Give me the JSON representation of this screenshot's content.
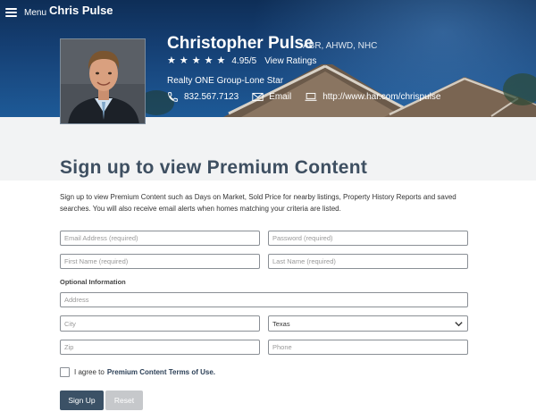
{
  "topbar": {
    "menu_label": "Menu",
    "site_agent_name": "Chris Pulse"
  },
  "agent": {
    "full_name": "Christopher Pulse",
    "credentials": "ABR, AHWD, NHC",
    "rating": "4.95/5",
    "stars": 5,
    "view_ratings_label": "View Ratings",
    "brokerage": "Realty ONE Group-Lone Star",
    "phone": "832.567.7123",
    "email_label": "Email",
    "website": "http://www.har.com/chrispulse"
  },
  "page": {
    "title": "Sign up to view Premium Content",
    "intro": "Sign up to view Premium Content such as Days on Market, Sold Price for nearby listings, Property History Reports and saved searches. You will also receive email alerts when homes matching your criteria are listed."
  },
  "form": {
    "email_placeholder": "Email Address (required)",
    "password_placeholder": "Password (required)",
    "first_name_placeholder": "First Name (required)",
    "last_name_placeholder": "Last Name (required)",
    "optional_label": "Optional Information",
    "address_placeholder": "Address",
    "city_placeholder": "City",
    "state_selected": "Texas",
    "zip_placeholder": "Zip",
    "phone_placeholder": "Phone",
    "agree_text": "I agree to",
    "terms_link": "Premium Content Terms of Use.",
    "signup_label": "Sign Up",
    "reset_label": "Reset"
  },
  "colors": {
    "hero_blue": "#143d70",
    "title": "#3e4f61",
    "primary_button": "#3b5166",
    "reset_button": "#c6c8cb",
    "band": "#f2f3f4"
  }
}
